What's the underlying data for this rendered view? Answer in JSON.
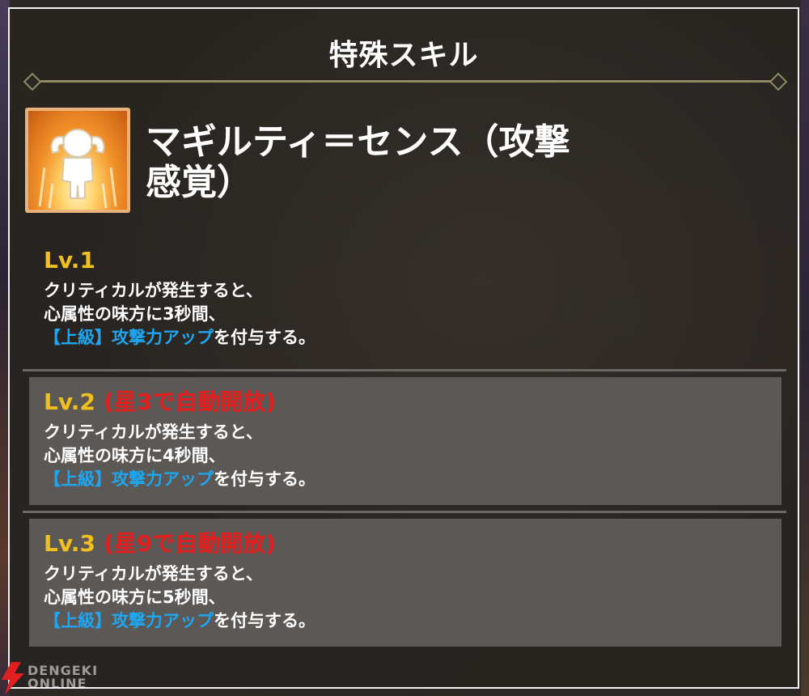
{
  "panel": {
    "title": "特殊スキル"
  },
  "skill": {
    "icon": "flexing-figure-icon",
    "name_line1": "マギルティ＝センス（攻撃",
    "name_line2": "感覚）"
  },
  "levels": [
    {
      "label": "Lv.1",
      "unlock": "",
      "line1": "クリティカルが発生すると、",
      "line2": "心属性の味方に3秒間、",
      "buff": "【上級】攻撃力アップ",
      "suffix": "を付与する。"
    },
    {
      "label": "Lv.2",
      "unlock": "(星3で自動開放)",
      "line1": "クリティカルが発生すると、",
      "line2": "心属性の味方に4秒間、",
      "buff": "【上級】攻撃力アップ",
      "suffix": "を付与する。"
    },
    {
      "label": "Lv.3",
      "unlock": "(星9で自動開放)",
      "line1": "クリティカルが発生すると、",
      "line2": "心属性の味方に5秒間、",
      "buff": "【上級】攻撃力アップ",
      "suffix": "を付与する。"
    }
  ],
  "watermark": {
    "line1": "DENGEKI",
    "line2": "ONLINE"
  },
  "colors": {
    "level_label": "#f2c01e",
    "unlock_text": "#e41c1c",
    "buff_text": "#1ea7f0",
    "divider": "#8e8a63",
    "locked_box": "#5b5856"
  }
}
